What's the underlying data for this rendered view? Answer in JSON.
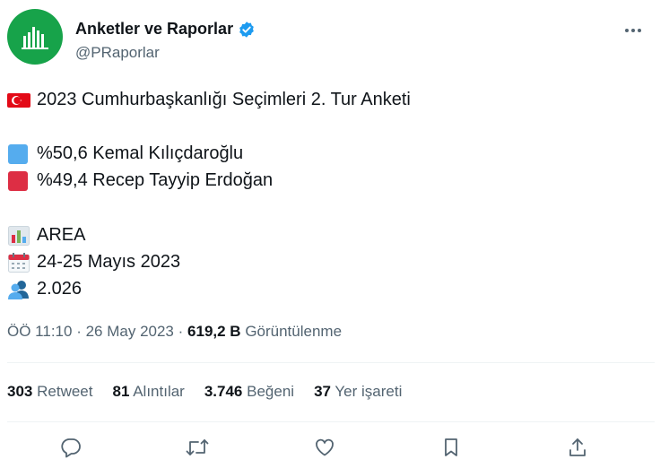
{
  "author": {
    "name": "Anketler ve Raporlar",
    "handle": "@PRaporlar",
    "verified": true,
    "avatar_color": "#17a34a"
  },
  "tweet": {
    "title_line": "2023 Cumhurbaşkanlığı Seçimleri 2. Tur Anketi",
    "candidates": [
      {
        "text": "%50,6 Kemal Kılıçdaroğlu",
        "color": "#55acee",
        "icon": "blue-square"
      },
      {
        "text": "%49,4 Recep Tayyip Erdoğan",
        "color": "#dd2e44",
        "icon": "red-square"
      }
    ],
    "company_line": "AREA",
    "date_line": "24-25 Mayıs 2023",
    "sample_line": "2.026"
  },
  "meta": {
    "time": "ÖÖ 11:10",
    "sep": "·",
    "date": "26 May 2023",
    "views_count": "619,2 B",
    "views_label": "Görüntülenme"
  },
  "stats": {
    "retweets": {
      "count": "303",
      "label": "Retweet"
    },
    "quotes": {
      "count": "81",
      "label": "Alıntılar"
    },
    "likes": {
      "count": "3.746",
      "label": "Beğeni"
    },
    "bookmarks": {
      "count": "37",
      "label": "Yer işareti"
    }
  },
  "colors": {
    "accent": "#1d9bf0",
    "text": "#0f1419",
    "muted": "#536471"
  }
}
